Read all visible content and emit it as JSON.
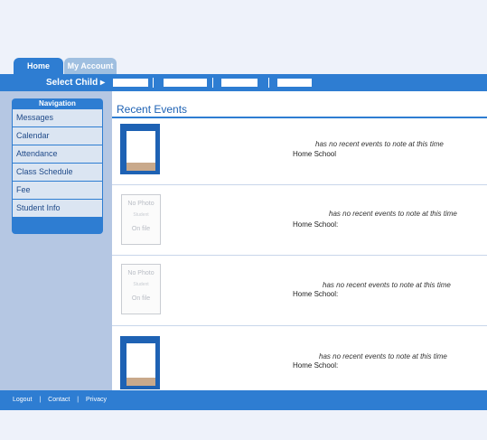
{
  "tabs": {
    "home": "Home",
    "account": "My Account"
  },
  "child_bar": {
    "label": "Select Child ▸",
    "separators": [
      "|",
      "|",
      "|"
    ]
  },
  "navigation": {
    "header": "Navigation",
    "items": [
      "Messages",
      "Calendar",
      "Attendance",
      "Class Schedule",
      "Fee",
      "Student Info"
    ]
  },
  "main": {
    "title": "Recent Events",
    "events": [
      {
        "message": "has no recent events to note at this time",
        "school": "Home School"
      },
      {
        "message": "has no recent events to note at this time",
        "school": "Home School:"
      },
      {
        "message": "has no recent events to note at this time",
        "school": "Home School:"
      },
      {
        "message": "has no recent events to note at this time",
        "school": "Home School:"
      }
    ],
    "no_photo": {
      "line1": "No Photo",
      "line2": "Student",
      "line3": "On file"
    }
  },
  "footer": {
    "links": [
      "Logout",
      "|",
      "Contact",
      "|",
      "Privacy"
    ]
  },
  "colors": {
    "brand": "#2e7dd2",
    "nav_bg": "#b5c7e3",
    "item_bg": "#dbe5f2"
  }
}
